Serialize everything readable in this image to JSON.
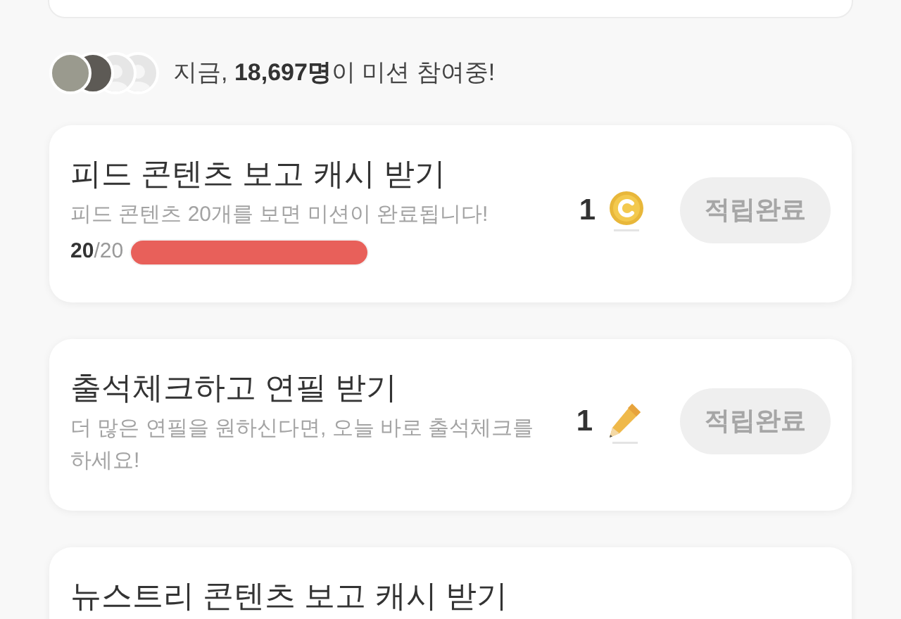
{
  "participants": {
    "avatars": [
      {
        "kind": "photo"
      },
      {
        "kind": "photo"
      },
      {
        "kind": "blank"
      },
      {
        "kind": "blank"
      }
    ],
    "text": "지금, **18,697명**이 미션 참여중!"
  },
  "missions": [
    {
      "title": "피드 콘텐츠 보고 캐시 받기",
      "description": "피드 콘텐츠 20개를 보면 미션이 완료됩니다!",
      "progress": {
        "text": "**20**/20",
        "level": 1
      },
      "reward": {
        "amount": "1",
        "kind": "coin"
      },
      "button": {
        "label": "적립완료",
        "disabled": true
      }
    },
    {
      "title": "출석체크하고 연필 받기",
      "description": "더 많은 연필을 원하신다면, 오늘 바로 출석체크를 하세요!",
      "reward": {
        "amount": "1",
        "kind": "pencil"
      },
      "button": {
        "label": "적립완료",
        "disabled": true
      }
    },
    {
      "title": "뉴스트리 콘텐츠 보고 캐시 받기"
    }
  ]
}
